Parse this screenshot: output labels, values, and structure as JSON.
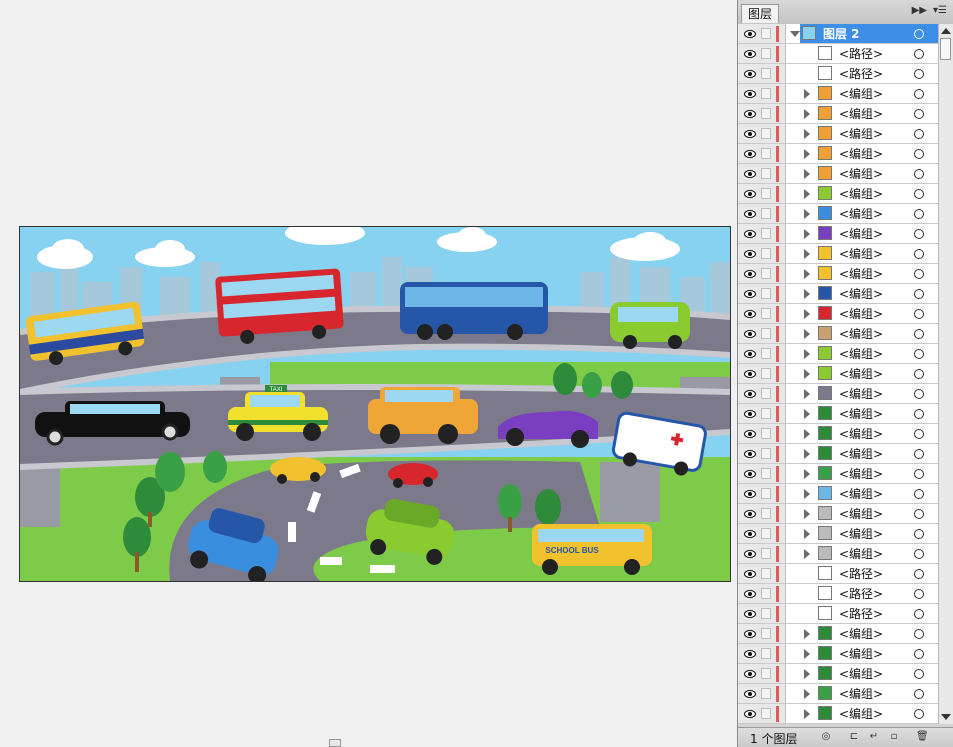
{
  "panel": {
    "tab_title": "图层",
    "collapse_icon": "double-chevron-right-icon",
    "menu_icon": "panel-menu-icon",
    "footer_count": "1 个图层",
    "footer_buttons": [
      "locate-object-icon",
      "make-clipping-mask-icon",
      "new-sublayer-icon",
      "new-layer-icon",
      "delete-layer-icon"
    ]
  },
  "layers": [
    {
      "label": "图层 2",
      "kind": "layer",
      "thumb": "art",
      "open": true,
      "selected": true
    },
    {
      "label": "<路径>",
      "kind": "path",
      "thumb": "blank"
    },
    {
      "label": "<路径>",
      "kind": "path",
      "thumb": "blank"
    },
    {
      "label": "<编组>",
      "kind": "group",
      "thumb": "flower"
    },
    {
      "label": "<编组>",
      "kind": "group",
      "thumb": "flower"
    },
    {
      "label": "<编组>",
      "kind": "group",
      "thumb": "flower"
    },
    {
      "label": "<编组>",
      "kind": "group",
      "thumb": "flower"
    },
    {
      "label": "<编组>",
      "kind": "group",
      "thumb": "flower"
    },
    {
      "label": "<编组>",
      "kind": "group",
      "thumb": "green-car"
    },
    {
      "label": "<编组>",
      "kind": "group",
      "thumb": "blue-car"
    },
    {
      "label": "<编组>",
      "kind": "group",
      "thumb": "purple-car"
    },
    {
      "label": "<编组>",
      "kind": "group",
      "thumb": "yellow-car"
    },
    {
      "label": "<编组>",
      "kind": "group",
      "thumb": "yellow-car"
    },
    {
      "label": "<编组>",
      "kind": "group",
      "thumb": "bus"
    },
    {
      "label": "<编组>",
      "kind": "group",
      "thumb": "red-bus"
    },
    {
      "label": "<编组>",
      "kind": "group",
      "thumb": "van"
    },
    {
      "label": "<编组>",
      "kind": "group",
      "thumb": "green-van"
    },
    {
      "label": "<编组>",
      "kind": "group",
      "thumb": "green-van"
    },
    {
      "label": "<编组>",
      "kind": "group",
      "thumb": "road"
    },
    {
      "label": "<编组>",
      "kind": "group",
      "thumb": "tree"
    },
    {
      "label": "<编组>",
      "kind": "group",
      "thumb": "tree"
    },
    {
      "label": "<编组>",
      "kind": "group",
      "thumb": "tree"
    },
    {
      "label": "<编组>",
      "kind": "group",
      "thumb": "dots"
    },
    {
      "label": "<编组>",
      "kind": "group",
      "thumb": "cloud"
    },
    {
      "label": "<编组>",
      "kind": "group",
      "thumb": "line"
    },
    {
      "label": "<编组>",
      "kind": "group",
      "thumb": "line"
    },
    {
      "label": "<编组>",
      "kind": "group",
      "thumb": "line"
    },
    {
      "label": "<路径>",
      "kind": "path",
      "thumb": "blank"
    },
    {
      "label": "<路径>",
      "kind": "path",
      "thumb": "blank"
    },
    {
      "label": "<路径>",
      "kind": "path",
      "thumb": "blank"
    },
    {
      "label": "<编组>",
      "kind": "group",
      "thumb": "tree"
    },
    {
      "label": "<编组>",
      "kind": "group",
      "thumb": "tree"
    },
    {
      "label": "<编组>",
      "kind": "group",
      "thumb": "tree"
    },
    {
      "label": "<编组>",
      "kind": "group",
      "thumb": "dots"
    },
    {
      "label": "<编组>",
      "kind": "group",
      "thumb": "tree"
    }
  ],
  "artwork": {
    "taxi_sign": "TAXI",
    "school_bus_text": "SCHOOL BUS"
  },
  "colors": {
    "selection": "#3d8ee6",
    "layer_color_bar": "#e05a5a",
    "sky": "#8fd6f0",
    "road": "#7c7a8a",
    "grass": "#7ecb4a"
  }
}
